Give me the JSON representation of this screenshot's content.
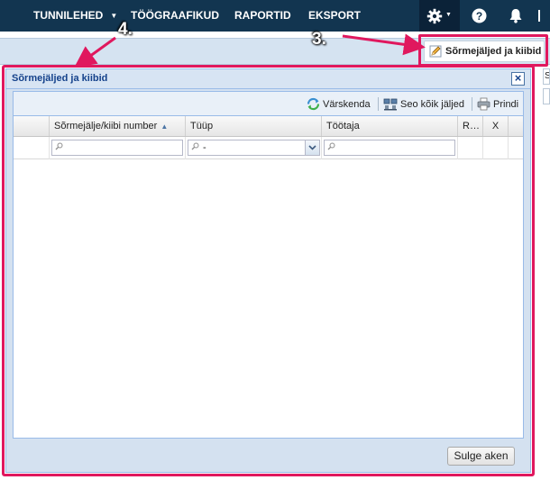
{
  "topnav": {
    "items": [
      {
        "label": "TUNNILEHED",
        "has_caret": true
      },
      {
        "label": "TÖÖGRAAFIKUD"
      },
      {
        "label": "RAPORTID"
      },
      {
        "label": "EKSPORT"
      }
    ],
    "icons": [
      "gear-icon",
      "help-icon",
      "bell-icon"
    ]
  },
  "background": {
    "cell_text": "S"
  },
  "annotations": {
    "step3": "3.",
    "step4": "4.",
    "highlight_color": "#e0185e"
  },
  "open_button": {
    "label": "Sõrmejäljed ja kiibid",
    "icon": "pencil-icon"
  },
  "dialog": {
    "title": "Sõrmejäljed ja kiibid",
    "close_glyph": "×",
    "toolbar": {
      "refresh_label": "Värskenda",
      "link_all_label": "Seo kõik jäljed",
      "print_label": "Prindi"
    },
    "columns": [
      {
        "label": ""
      },
      {
        "label": "Sõrmejälje/kiibi number",
        "sorted": "asc"
      },
      {
        "label": "Tüüp"
      },
      {
        "label": "Töötaja"
      },
      {
        "label": "R…"
      },
      {
        "label": "X"
      }
    ],
    "filters": {
      "number_value": "",
      "type_value": "-",
      "employee_value": ""
    },
    "rows": [],
    "close_button_label": "Sulge aken"
  }
}
